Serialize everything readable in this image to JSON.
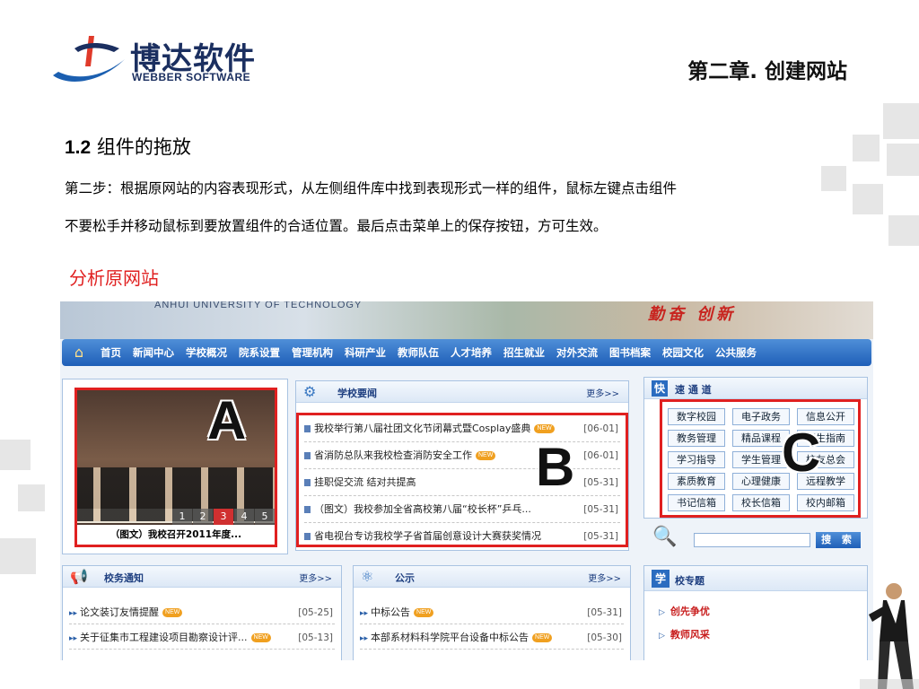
{
  "header": {
    "logo_cn": "博达软件",
    "logo_en": "WEBBER SOFTWARE",
    "chapter_title": "第二章. 创建网站"
  },
  "section": {
    "number": "1.2",
    "title": "组件的拖放",
    "line1": "第二步：根据原网站的内容表现形式，从左侧组件库中找到表现形式一样的组件，鼠标左键点击组件",
    "line2": "不要松手并移动鼠标到要放置组件的合适位置。最后点击菜单上的保存按钮，方可生效。",
    "subheading": "分析原网站"
  },
  "site": {
    "banner_en": "ANHUI UNIVERSITY OF TECHNOLOGY",
    "banner_motto": "勤奋 创新",
    "nav": [
      "首页",
      "新闻中心",
      "学校概况",
      "院系设置",
      "管理机构",
      "科研产业",
      "教师队伍",
      "人才培养",
      "招生就业",
      "对外交流",
      "图书档案",
      "校园文化",
      "公共服务"
    ],
    "photo": {
      "caption": "（图文）我校召开2011年度...",
      "pages": [
        "1",
        "2",
        "3",
        "4",
        "5"
      ],
      "active_page": "3"
    },
    "news": {
      "title": "学校要闻",
      "more": "更多>>",
      "badge": "NEW",
      "items": [
        {
          "text": "我校举行第八届社团文化节闭幕式暨Cosplay盛典",
          "date": "[06-01]",
          "new": true
        },
        {
          "text": "省消防总队来我校检查消防安全工作",
          "date": "[06-01]",
          "new": true
        },
        {
          "text": "挂职促交流 结对共提高",
          "date": "[05-31]",
          "new": false
        },
        {
          "text": "（图文）我校参加全省高校第八届“校长杯”乒乓...",
          "date": "[05-31]",
          "new": false
        },
        {
          "text": "省电视台专访我校学子省首届创意设计大赛获奖情况",
          "date": "[05-31]",
          "new": false
        }
      ]
    },
    "quick": {
      "icon_char": "快",
      "title": "速 通 道",
      "buttons": [
        "数字校园",
        "电子政务",
        "信息公开",
        "教务管理",
        "精品课程",
        "招生指南",
        "学习指导",
        "学生管理",
        "校友总会",
        "素质教育",
        "心理健康",
        "远程教学",
        "书记信箱",
        "校长信箱",
        "校内邮箱"
      ]
    },
    "search": {
      "button": "搜 索"
    },
    "notice": {
      "title": "校务通知",
      "more": "更多>>",
      "items": [
        {
          "text": "论文装订友情提醒",
          "date": "[05-25]"
        },
        {
          "text": "关于征集市工程建设项目勘察设计评...",
          "date": "[05-13]"
        }
      ]
    },
    "public": {
      "title": "公示",
      "more": "更多>>",
      "items": [
        {
          "text": "中标公告",
          "date": "[05-31]"
        },
        {
          "text": "本部系材料科学院平台设备中标公告",
          "date": "[05-30]"
        }
      ]
    },
    "topic": {
      "icon_char": "学",
      "title": "校专题",
      "items": [
        "创先争优",
        "教师风采"
      ]
    }
  },
  "annotations": {
    "a": "A",
    "b": "B",
    "c": "C"
  },
  "colors": {
    "accent_red": "#e02020",
    "nav_blue": "#1f5fb8",
    "brand_navy": "#1b2f60"
  }
}
